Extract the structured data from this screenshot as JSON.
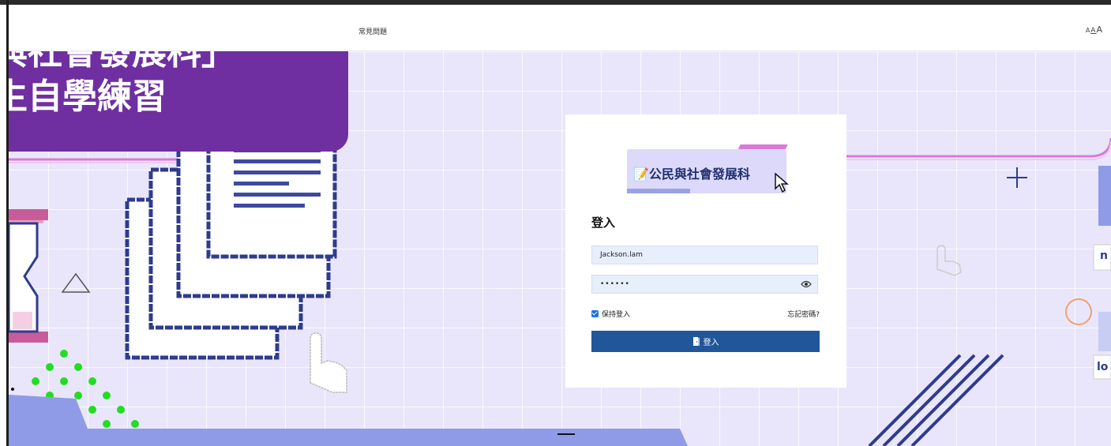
{
  "banner": {
    "line1": "與社會發展科」",
    "line2": "生自學練習"
  },
  "header": {
    "faq_label": "常見問題",
    "font_size_small": "A",
    "font_size_medium": "A",
    "font_size_large": "A"
  },
  "login": {
    "logo_text": "📝公民與社會發展科",
    "heading": "登入",
    "username_value": "Jackson.lam",
    "password_value": "••••••",
    "remember_label": "保持登入",
    "remember_checked": true,
    "forgot_label": "忘記密碼?",
    "submit_label": "登入"
  },
  "icons": {
    "eye": "eye-icon",
    "door": "door-icon",
    "cursor": "mouse-cursor-icon"
  },
  "side_labels": {
    "right_top": "n",
    "right_bottom": "lo"
  },
  "colors": {
    "banner": "#6f2fa1",
    "background": "#e9e6fb",
    "login_button": "#22569b",
    "accent_pink": "#d87ad6",
    "dots": "#22dd22"
  }
}
